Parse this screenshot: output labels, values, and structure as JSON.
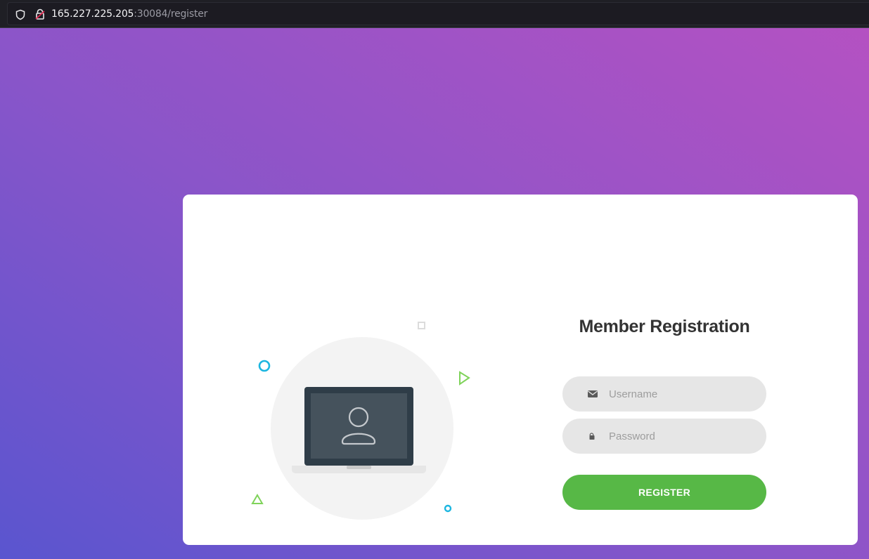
{
  "browser": {
    "url_host": "165.227.225.205",
    "url_path": ":30084/register"
  },
  "form": {
    "title": "Member Registration",
    "username_placeholder": "Username",
    "password_placeholder": "Password",
    "register_label": "REGISTER"
  },
  "icons": {
    "browser": [
      "shield-icon",
      "lock-icon"
    ],
    "fields": [
      "envelope-icon",
      "lock-icon"
    ],
    "illustration": [
      "laptop-icon",
      "user-icon",
      "circle-decoration",
      "triangle-decoration",
      "square-decoration"
    ]
  },
  "colors": {
    "accent_button": "#57b846",
    "field_background": "#e6e6e6",
    "decor_blue": "#1cb6e0",
    "decor_green": "#7fd35a",
    "laptop_dark": "#2f3d48",
    "laptop_screen": "#45525c"
  }
}
